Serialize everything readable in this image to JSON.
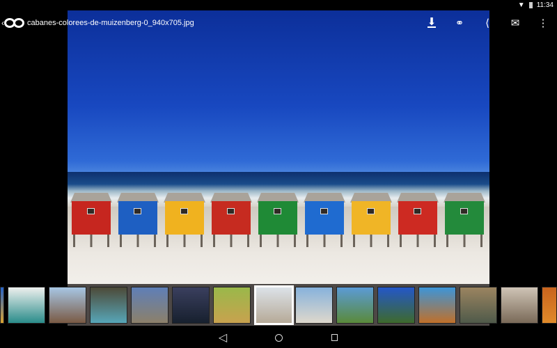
{
  "status_bar": {
    "time": "11:34",
    "icons": [
      "wifi-icon",
      "battery-icon"
    ]
  },
  "toolbar": {
    "title": "cabanes-colorees-de-muizenberg-0_940x705.jpg",
    "actions": [
      "download",
      "link",
      "share",
      "email",
      "more"
    ]
  },
  "photo": {
    "huts": [
      "#c6261f",
      "#1e5fc2",
      "#f0b21f",
      "#c62b20",
      "#1f8a36",
      "#1f6bd0",
      "#f0b526",
      "#cd2a22",
      "#238a3b"
    ]
  },
  "thumbnails": [
    {
      "colors": [
        "#2563c9",
        "#d9a330"
      ]
    },
    {
      "colors": [
        "#eef0ee",
        "#2a8c8a"
      ]
    },
    {
      "colors": [
        "#a7c6e4",
        "#7a5a44"
      ]
    },
    {
      "colors": [
        "#4d4a38",
        "#57a6b8"
      ]
    },
    {
      "colors": [
        "#5f7fb7",
        "#8c806a"
      ]
    },
    {
      "colors": [
        "#3a3f5e",
        "#17202e"
      ]
    },
    {
      "colors": [
        "#9ab84a",
        "#c8a24e"
      ]
    },
    {
      "colors": [
        "#dce2e8",
        "#b6aa98"
      ],
      "selected": true
    },
    {
      "colors": [
        "#87b2dc",
        "#ded8cc"
      ]
    },
    {
      "colors": [
        "#5b9bd6",
        "#5a8a3a"
      ]
    },
    {
      "colors": [
        "#2457c8",
        "#3e6a2c"
      ]
    },
    {
      "colors": [
        "#3d95d8",
        "#c0702a"
      ]
    },
    {
      "colors": [
        "#9b8460",
        "#4f5a4a"
      ]
    },
    {
      "colors": [
        "#cfc4b6",
        "#7a6a58"
      ]
    },
    {
      "colors": [
        "#c8641e",
        "#e08a2a"
      ]
    }
  ]
}
